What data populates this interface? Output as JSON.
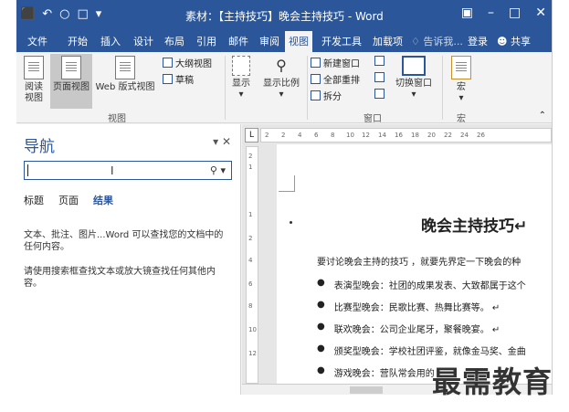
{
  "titlebar": {
    "qat_save": "⬛",
    "qat_undo": "↶",
    "qat_redo": "○",
    "qat_preview": "□",
    "qat_more": "▾",
    "title": "素材：【主持技巧】晚会主持技巧 - Word",
    "ribbon_opts": "▣",
    "minimize": "–",
    "maximize": "□",
    "close": "✕"
  },
  "tabs": [
    {
      "label": "文件"
    },
    {
      "label": "开始"
    },
    {
      "label": "插入"
    },
    {
      "label": "设计"
    },
    {
      "label": "布局"
    },
    {
      "label": "引用"
    },
    {
      "label": "邮件"
    },
    {
      "label": "审阅"
    },
    {
      "label": "视图"
    },
    {
      "label": "开发工具"
    },
    {
      "label": "加载项"
    }
  ],
  "tell_me": "♢ 告诉我...",
  "login": "登录",
  "share": "共享",
  "ribbon": {
    "read_mode": "阅读\n视图",
    "print_layout": "页面视图",
    "web_layout": "Web 版式视图",
    "outline": "大纲视图",
    "draft": "草稿",
    "group_views": "视图",
    "show": "显示",
    "zoom": "显示比例",
    "new_window": "新建窗口",
    "arrange_all": "全部重排",
    "split": "拆分",
    "switch_window": "切换窗口",
    "group_window": "窗口",
    "macros": "宏",
    "group_macros": "宏"
  },
  "nav": {
    "title": "导航",
    "search_placeholder": "",
    "tab_headings": "标题",
    "tab_pages": "页面",
    "tab_results": "结果",
    "msg1": "文本、批注、图片...Word 可以查找您的文档中的任何内容。",
    "msg2": "请使用搜索框查找文本或放大镜查找任何其他内容。"
  },
  "hruler": [
    "2",
    "2",
    "4",
    "6",
    "8",
    "10",
    "12",
    "14",
    "16",
    "18",
    "20",
    "22",
    "24",
    "26"
  ],
  "vruler": [
    "2",
    "1",
    "1",
    "2",
    "4",
    "6",
    "8",
    "10",
    "12"
  ],
  "doc": {
    "heading": "晚会主持技巧↵",
    "intro": "要讨论晚会主持的技巧 ，就要先界定一下晚会的种",
    "items": [
      "表演型晚会：社团的成果发表、大致都属于这个",
      "比赛型晚会：民歌比赛、热舞比赛等。 ↵",
      "联欢晚会：公司企业尾牙，聚餐晚宴。 ↵",
      "颁奖型晚会：学校社团评鉴，就像金马奖、金曲",
      "游戏晚会：营队常会用的"
    ]
  },
  "watermark": "最需教育",
  "colors": {
    "accent": "#2b579a"
  }
}
